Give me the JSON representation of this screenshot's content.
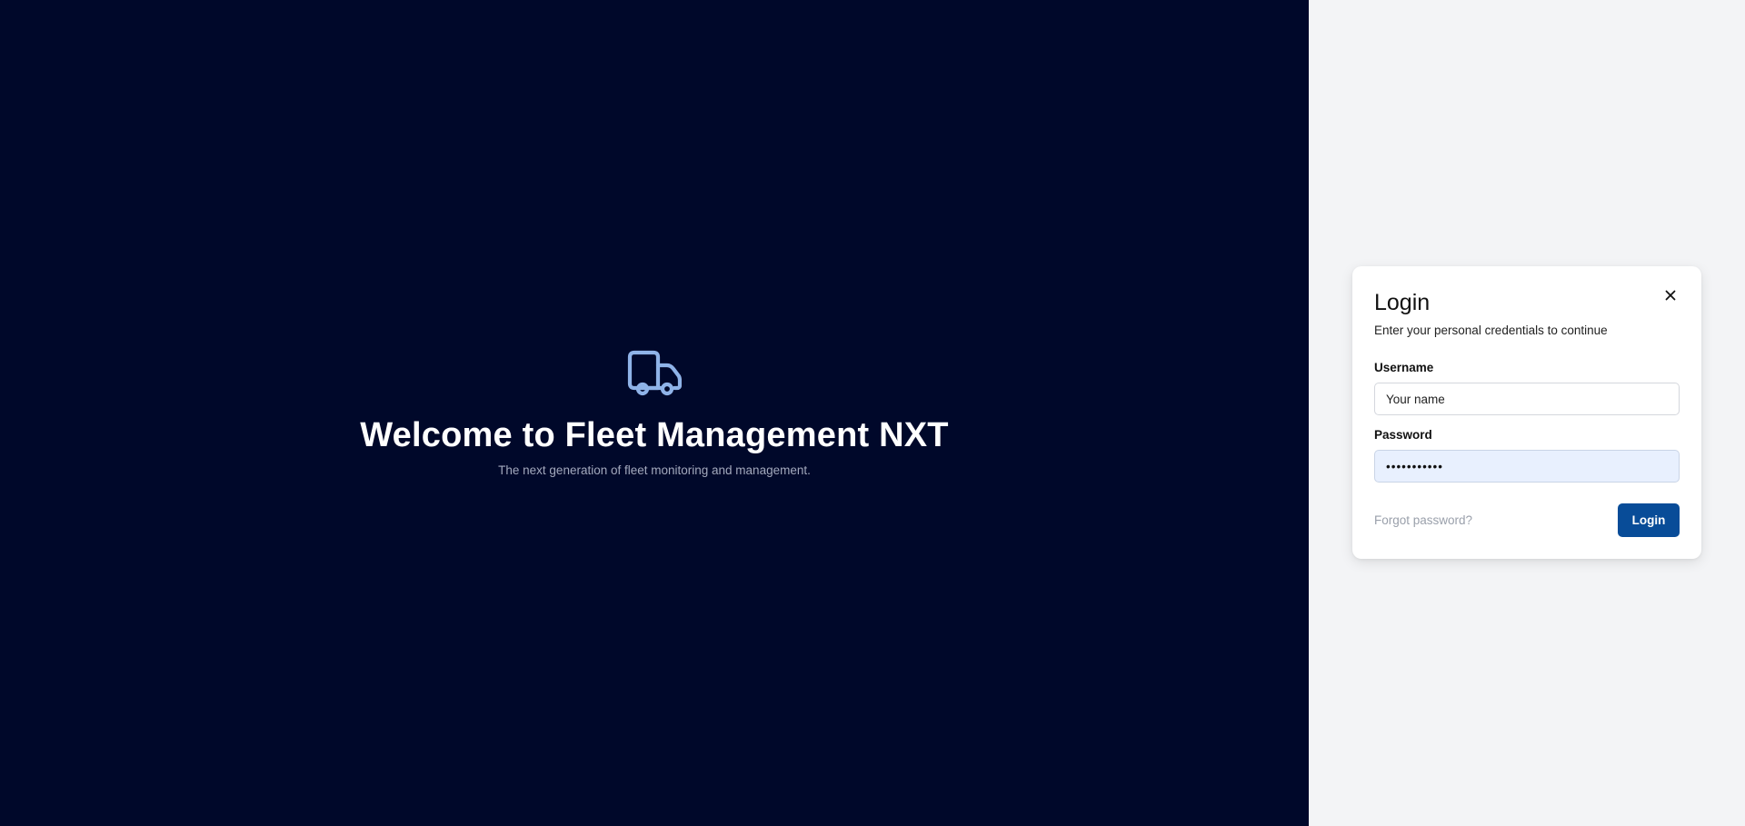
{
  "hero": {
    "title": "Welcome to Fleet Management NXT",
    "subtitle": "The next generation of fleet monitoring and management.",
    "icon": "truck-icon",
    "background": "#00082a",
    "icon_color": "#8fb3e8"
  },
  "login": {
    "title": "Login",
    "subtitle": "Enter your personal credentials to continue",
    "close_icon": "close-icon",
    "username": {
      "label": "Username",
      "placeholder": "Your name",
      "value": ""
    },
    "password": {
      "label": "Password",
      "value": "•••••••••••"
    },
    "forgot_label": "Forgot password?",
    "submit_label": "Login",
    "accent": "#084c98"
  }
}
